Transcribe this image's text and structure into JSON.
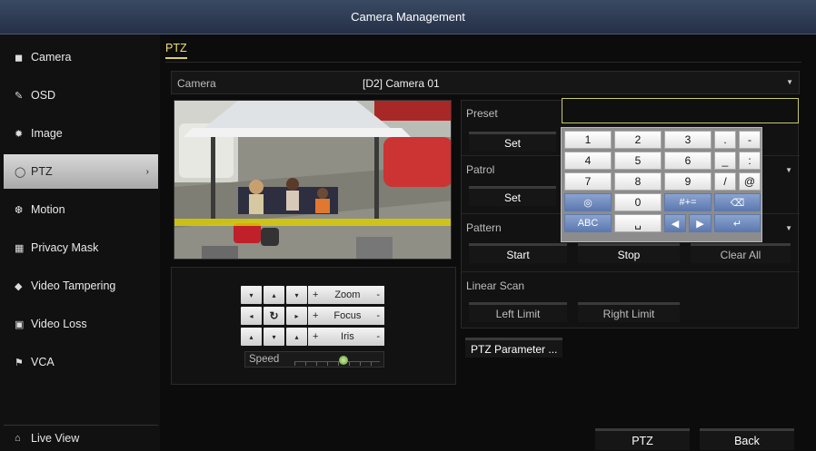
{
  "window": {
    "title": "Camera Management"
  },
  "sidebar": {
    "items": [
      {
        "label": "Camera",
        "icon": "camera-icon"
      },
      {
        "label": "OSD",
        "icon": "osd-icon"
      },
      {
        "label": "Image",
        "icon": "image-icon"
      },
      {
        "label": "PTZ",
        "icon": "ptz-icon",
        "active": true
      },
      {
        "label": "Motion",
        "icon": "motion-icon"
      },
      {
        "label": "Privacy Mask",
        "icon": "privacy-mask-icon"
      },
      {
        "label": "Video Tampering",
        "icon": "video-tampering-icon"
      },
      {
        "label": "Video Loss",
        "icon": "video-loss-icon"
      },
      {
        "label": "VCA",
        "icon": "vca-icon"
      }
    ],
    "live_view": "Live View"
  },
  "tabs": {
    "active": "PTZ"
  },
  "camera": {
    "label": "Camera",
    "value": "[D2] Camera 01"
  },
  "controls": {
    "zoom": "Zoom",
    "focus": "Focus",
    "iris": "Iris",
    "speed_label": "Speed",
    "speed_level": 4,
    "speed_max": 7,
    "plus": "+",
    "minus": "-"
  },
  "preset": {
    "label": "Preset",
    "set": "Set"
  },
  "patrol": {
    "label": "Patrol",
    "set": "Set"
  },
  "pattern": {
    "label": "Pattern",
    "start": "Start",
    "stop": "Stop",
    "clear_all": "Clear All"
  },
  "linear_scan": {
    "label": "Linear Scan",
    "left_limit": "Left Limit",
    "right_limit": "Right Limit"
  },
  "ptz_parameter": "PTZ Parameter ...",
  "keyboard": {
    "row1": [
      "1",
      "2",
      "3",
      ".",
      "-"
    ],
    "row2": [
      "4",
      "5",
      "6",
      "_",
      ":"
    ],
    "row3": [
      "7",
      "8",
      "9",
      "/",
      "@"
    ],
    "row4": [
      "0",
      "#+="
    ],
    "abc": "ABC"
  },
  "footer": {
    "ptz": "PTZ",
    "back": "Back"
  },
  "colors": {
    "accent_tab": "#e0d060",
    "title_bar": "#2e3b54",
    "key_blue": "#6b86bd",
    "input_border": "#c9c96a"
  }
}
